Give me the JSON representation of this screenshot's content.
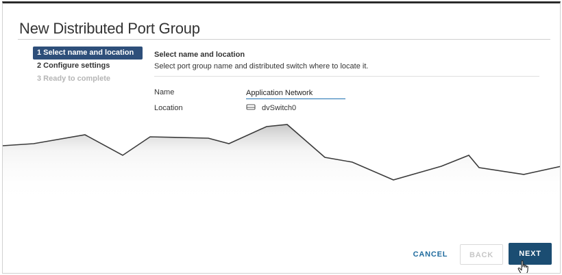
{
  "dialog": {
    "title": "New Distributed Port Group"
  },
  "steps": [
    {
      "label": "1 Select name and location",
      "state": "active"
    },
    {
      "label": "2 Configure settings",
      "state": "enabled"
    },
    {
      "label": "3 Ready to complete",
      "state": "disabled"
    }
  ],
  "section": {
    "title": "Select name and location",
    "description": "Select port group name and distributed switch where to locate it."
  },
  "form": {
    "name_label": "Name",
    "name_value": "Application Network",
    "location_label": "Location",
    "location_value": "dvSwitch0",
    "location_icon": "switch-icon"
  },
  "buttons": {
    "cancel": "CANCEL",
    "back": "BACK",
    "next": "NEXT"
  },
  "colors": {
    "active_step": "#2e4f7a",
    "next_button": "#1b4d72",
    "link": "#1f6b9e",
    "input_underline": "#1b6fb0"
  }
}
